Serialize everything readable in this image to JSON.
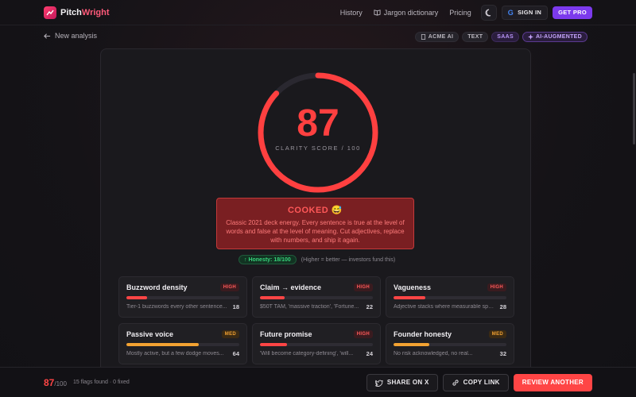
{
  "header": {
    "brand_prefix": "Pitch",
    "brand_suffix": "Wright",
    "nav": {
      "history": "History",
      "jargon": "Jargon dictionary",
      "pricing": "Pricing"
    },
    "signin": "SIGN IN",
    "getpro": "GET PRO",
    "google_glyph": "G"
  },
  "subbar": {
    "back": "New analysis",
    "tags": {
      "company": "ACME AI",
      "format": "TEXT",
      "sector": "SAAS",
      "ai": "AI-AUGMENTED"
    }
  },
  "score": {
    "value": "87",
    "label": "CLARITY SCORE / 100",
    "fraction": 0.87,
    "color": "#ff4040"
  },
  "verdict": {
    "title": "COOKED 😅",
    "text": "Classic 2021 deck energy. Every sentence is true at the level of words and false at the level of meaning. Cut adjectives, replace with numbers, and ship it again."
  },
  "honesty": {
    "pill": "↑ Honesty: 18/100",
    "note": "(Higher = better — investors fund this)"
  },
  "metrics": [
    {
      "name": "Buzzword density",
      "level": "HIGH",
      "fill": 0.18,
      "desc": "Tier-1 buzzwords every other sentence...",
      "value": "18"
    },
    {
      "name": "Claim → evidence",
      "level": "HIGH",
      "fill": 0.22,
      "desc": "$50T TAM, 'massive traction', 'Fortune...",
      "value": "22"
    },
    {
      "name": "Vagueness",
      "level": "HIGH",
      "fill": 0.28,
      "desc": "Adjective stacks where measurable spe...",
      "value": "28"
    },
    {
      "name": "Passive voice",
      "level": "MED",
      "fill": 0.64,
      "desc": "Mostly active, but a few dodge moves...",
      "value": "64"
    },
    {
      "name": "Future promise",
      "level": "HIGH",
      "fill": 0.24,
      "desc": "'Will become category-defining', 'will...",
      "value": "24"
    },
    {
      "name": "Founder honesty",
      "level": "MED",
      "fill": 0.32,
      "desc": "No risk acknowledged, no real...",
      "value": "32"
    }
  ],
  "footer": {
    "score": "87",
    "denom": "/100",
    "flags": "15 flags found · 0 fixed",
    "share": "SHARE ON X",
    "copy": "COPY LINK",
    "review": "REVIEW ANOTHER"
  },
  "colors": {
    "accent_red": "#ff4545",
    "accent_purple": "#7c3aed",
    "med_orange": "#f2a232",
    "honesty_green": "#36d27a"
  }
}
